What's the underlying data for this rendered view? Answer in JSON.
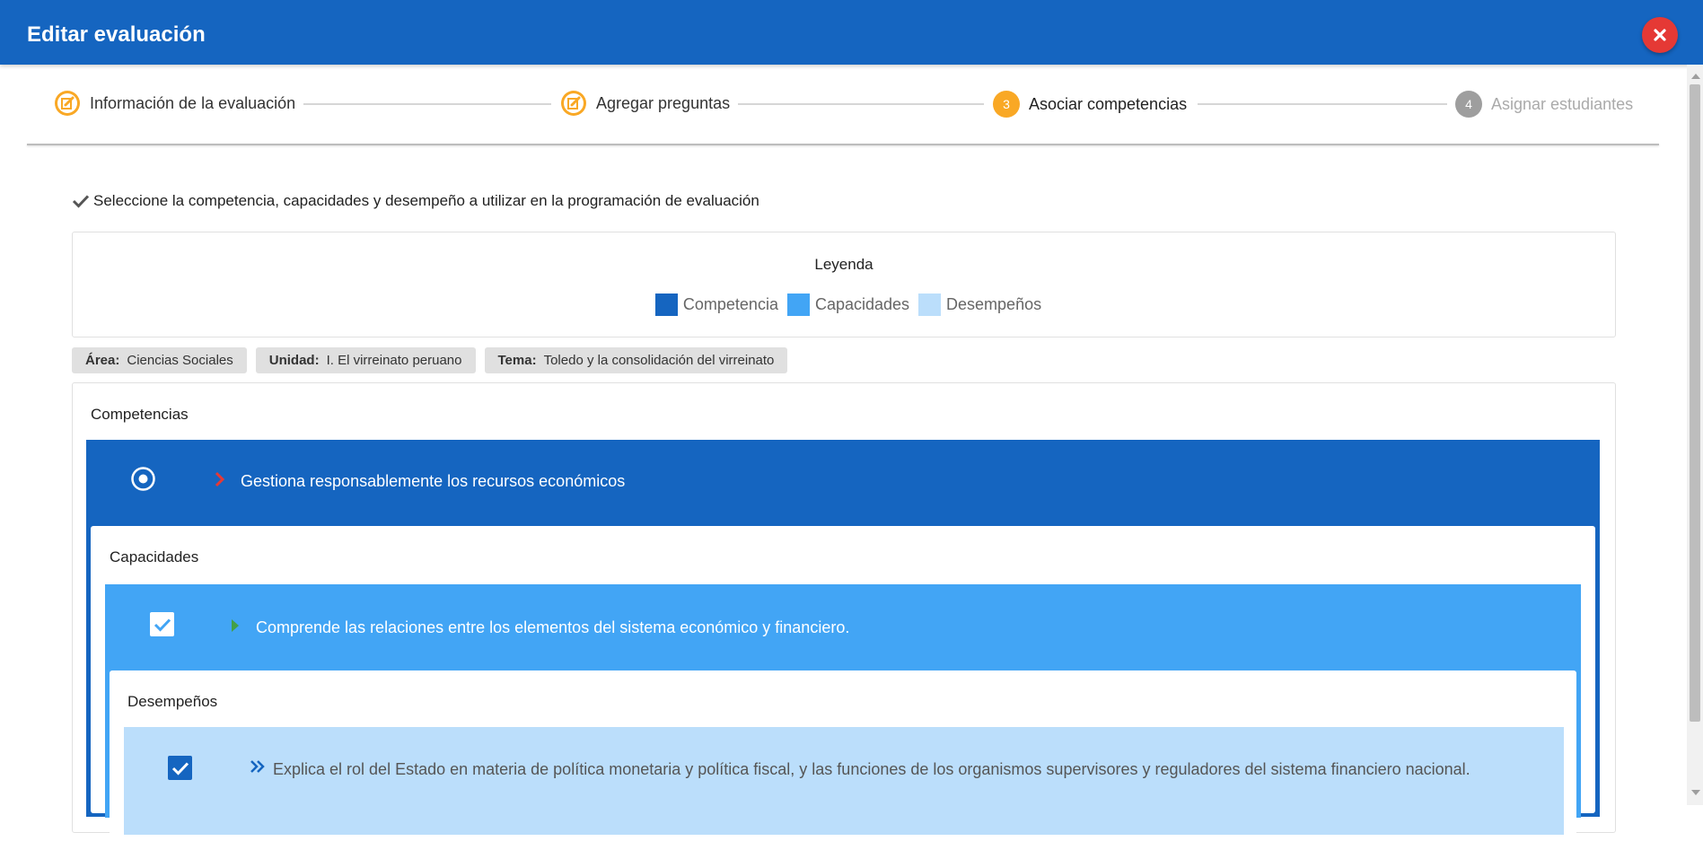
{
  "header": {
    "title": "Editar evaluación",
    "close_icon": "close-icon",
    "bg_color": "#1565c0",
    "close_color": "#e53935"
  },
  "stepper": {
    "steps": [
      {
        "label": "Información de la evaluación",
        "state": "completed",
        "icon": "edit-icon",
        "color": "#f9a825"
      },
      {
        "label": "Agregar preguntas",
        "state": "completed",
        "icon": "edit-icon",
        "color": "#f9a825"
      },
      {
        "number": "3",
        "label": "Asociar competencias",
        "state": "active",
        "color": "#f9a825"
      },
      {
        "number": "4",
        "label": "Asignar estudiantes",
        "state": "inactive",
        "color": "#9e9e9e"
      }
    ]
  },
  "instruction": {
    "icon": "check-icon",
    "text": "Seleccione la competencia, capacidades y desempeño a utilizar en la programación de evaluación"
  },
  "legend": {
    "title": "Leyenda",
    "items": [
      {
        "label": "Competencia",
        "color": "#1565c0"
      },
      {
        "label": "Capacidades",
        "color": "#42a5f5"
      },
      {
        "label": "Desempeños",
        "color": "#bbdefb"
      }
    ]
  },
  "chips": [
    {
      "key": "Área:",
      "value": "Ciencias Sociales"
    },
    {
      "key": "Unidad:",
      "value": "I. El virreinato peruano"
    },
    {
      "key": "Tema:",
      "value": "Toledo y la consolidación del virreinato"
    }
  ],
  "competencias": {
    "title": "Competencias",
    "item": {
      "text": "Gestiona responsablemente los recursos económicos",
      "selected": true
    }
  },
  "capacidades": {
    "title": "Capacidades",
    "item": {
      "text": "Comprende las relaciones entre los elementos del sistema económico y financiero.",
      "checked": true
    }
  },
  "desempenos": {
    "title": "Desempeños",
    "item": {
      "text": "Explica el rol del Estado en materia de política monetaria y política fiscal, y las funciones de los organismos supervisores y reguladores del sistema financiero nacional.",
      "checked": true
    }
  }
}
